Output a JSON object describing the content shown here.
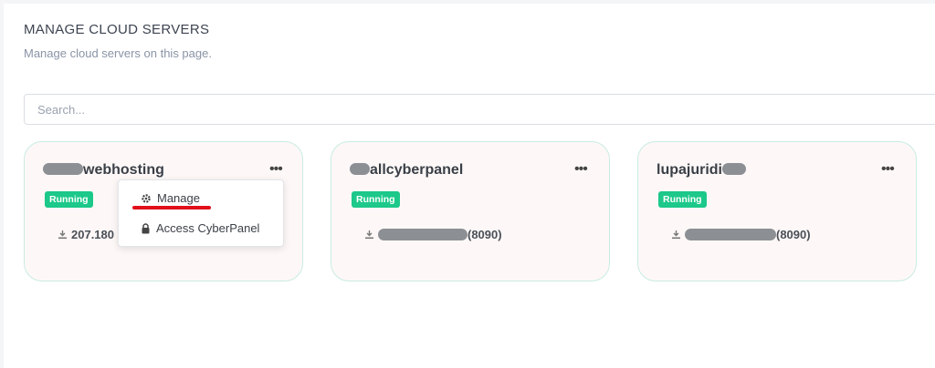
{
  "header": {
    "title": "MANAGE CLOUD SERVERS",
    "subtitle": "Manage cloud servers on this page."
  },
  "search": {
    "placeholder": "Search...",
    "value": ""
  },
  "cards": [
    {
      "name_suffix": "webhosting",
      "status": "Running",
      "address": "207.180",
      "menu_icon": "ellipsis-icon"
    },
    {
      "name_suffix": "allcyberpanel",
      "status": "Running",
      "address_suffix": "(8090)",
      "menu_icon": "ellipsis-icon"
    },
    {
      "name_prefix": "lupajuridi",
      "status": "Running",
      "address_suffix": "(8090)",
      "menu_icon": "ellipsis-icon"
    }
  ],
  "dropdown": {
    "items": [
      {
        "label": "Manage",
        "icon": "gear-icon"
      },
      {
        "label": "Access CyberPanel",
        "icon": "lock-icon"
      }
    ]
  },
  "colors": {
    "running_badge": "#1cc88a",
    "card_border": "#c9ebe3",
    "card_bg": "#fdf8f7",
    "annotation_underline": "#e0101a"
  }
}
